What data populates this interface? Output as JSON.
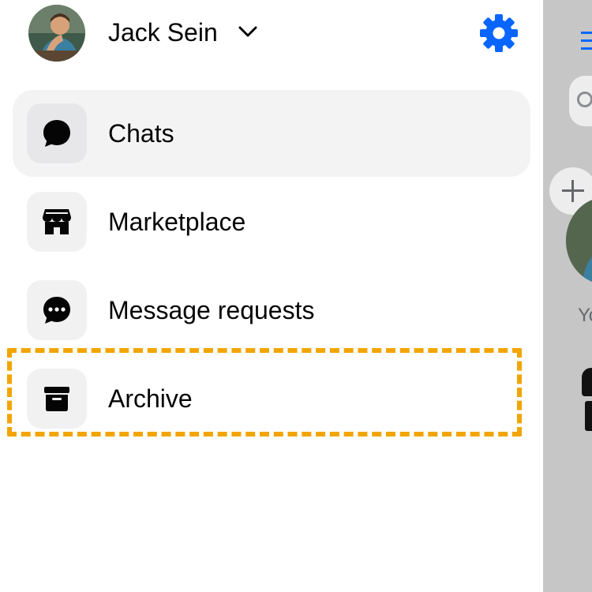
{
  "profile": {
    "name": "Jack Sein"
  },
  "menu": {
    "items": [
      {
        "label": "Chats",
        "icon": "chat-bubble-icon",
        "active": true
      },
      {
        "label": "Marketplace",
        "icon": "storefront-icon",
        "active": false
      },
      {
        "label": "Message requests",
        "icon": "message-requests-icon",
        "active": false
      },
      {
        "label": "Archive",
        "icon": "archive-icon",
        "active": false
      }
    ]
  },
  "background_panel": {
    "your_story_label": "Yo"
  },
  "colors": {
    "accent": "#0866ff",
    "highlight": "#f2a500",
    "active_row": "#f3f3f4",
    "icon_tile": "#f1f1f2",
    "dimmed_panel": "#c6c6c7"
  }
}
